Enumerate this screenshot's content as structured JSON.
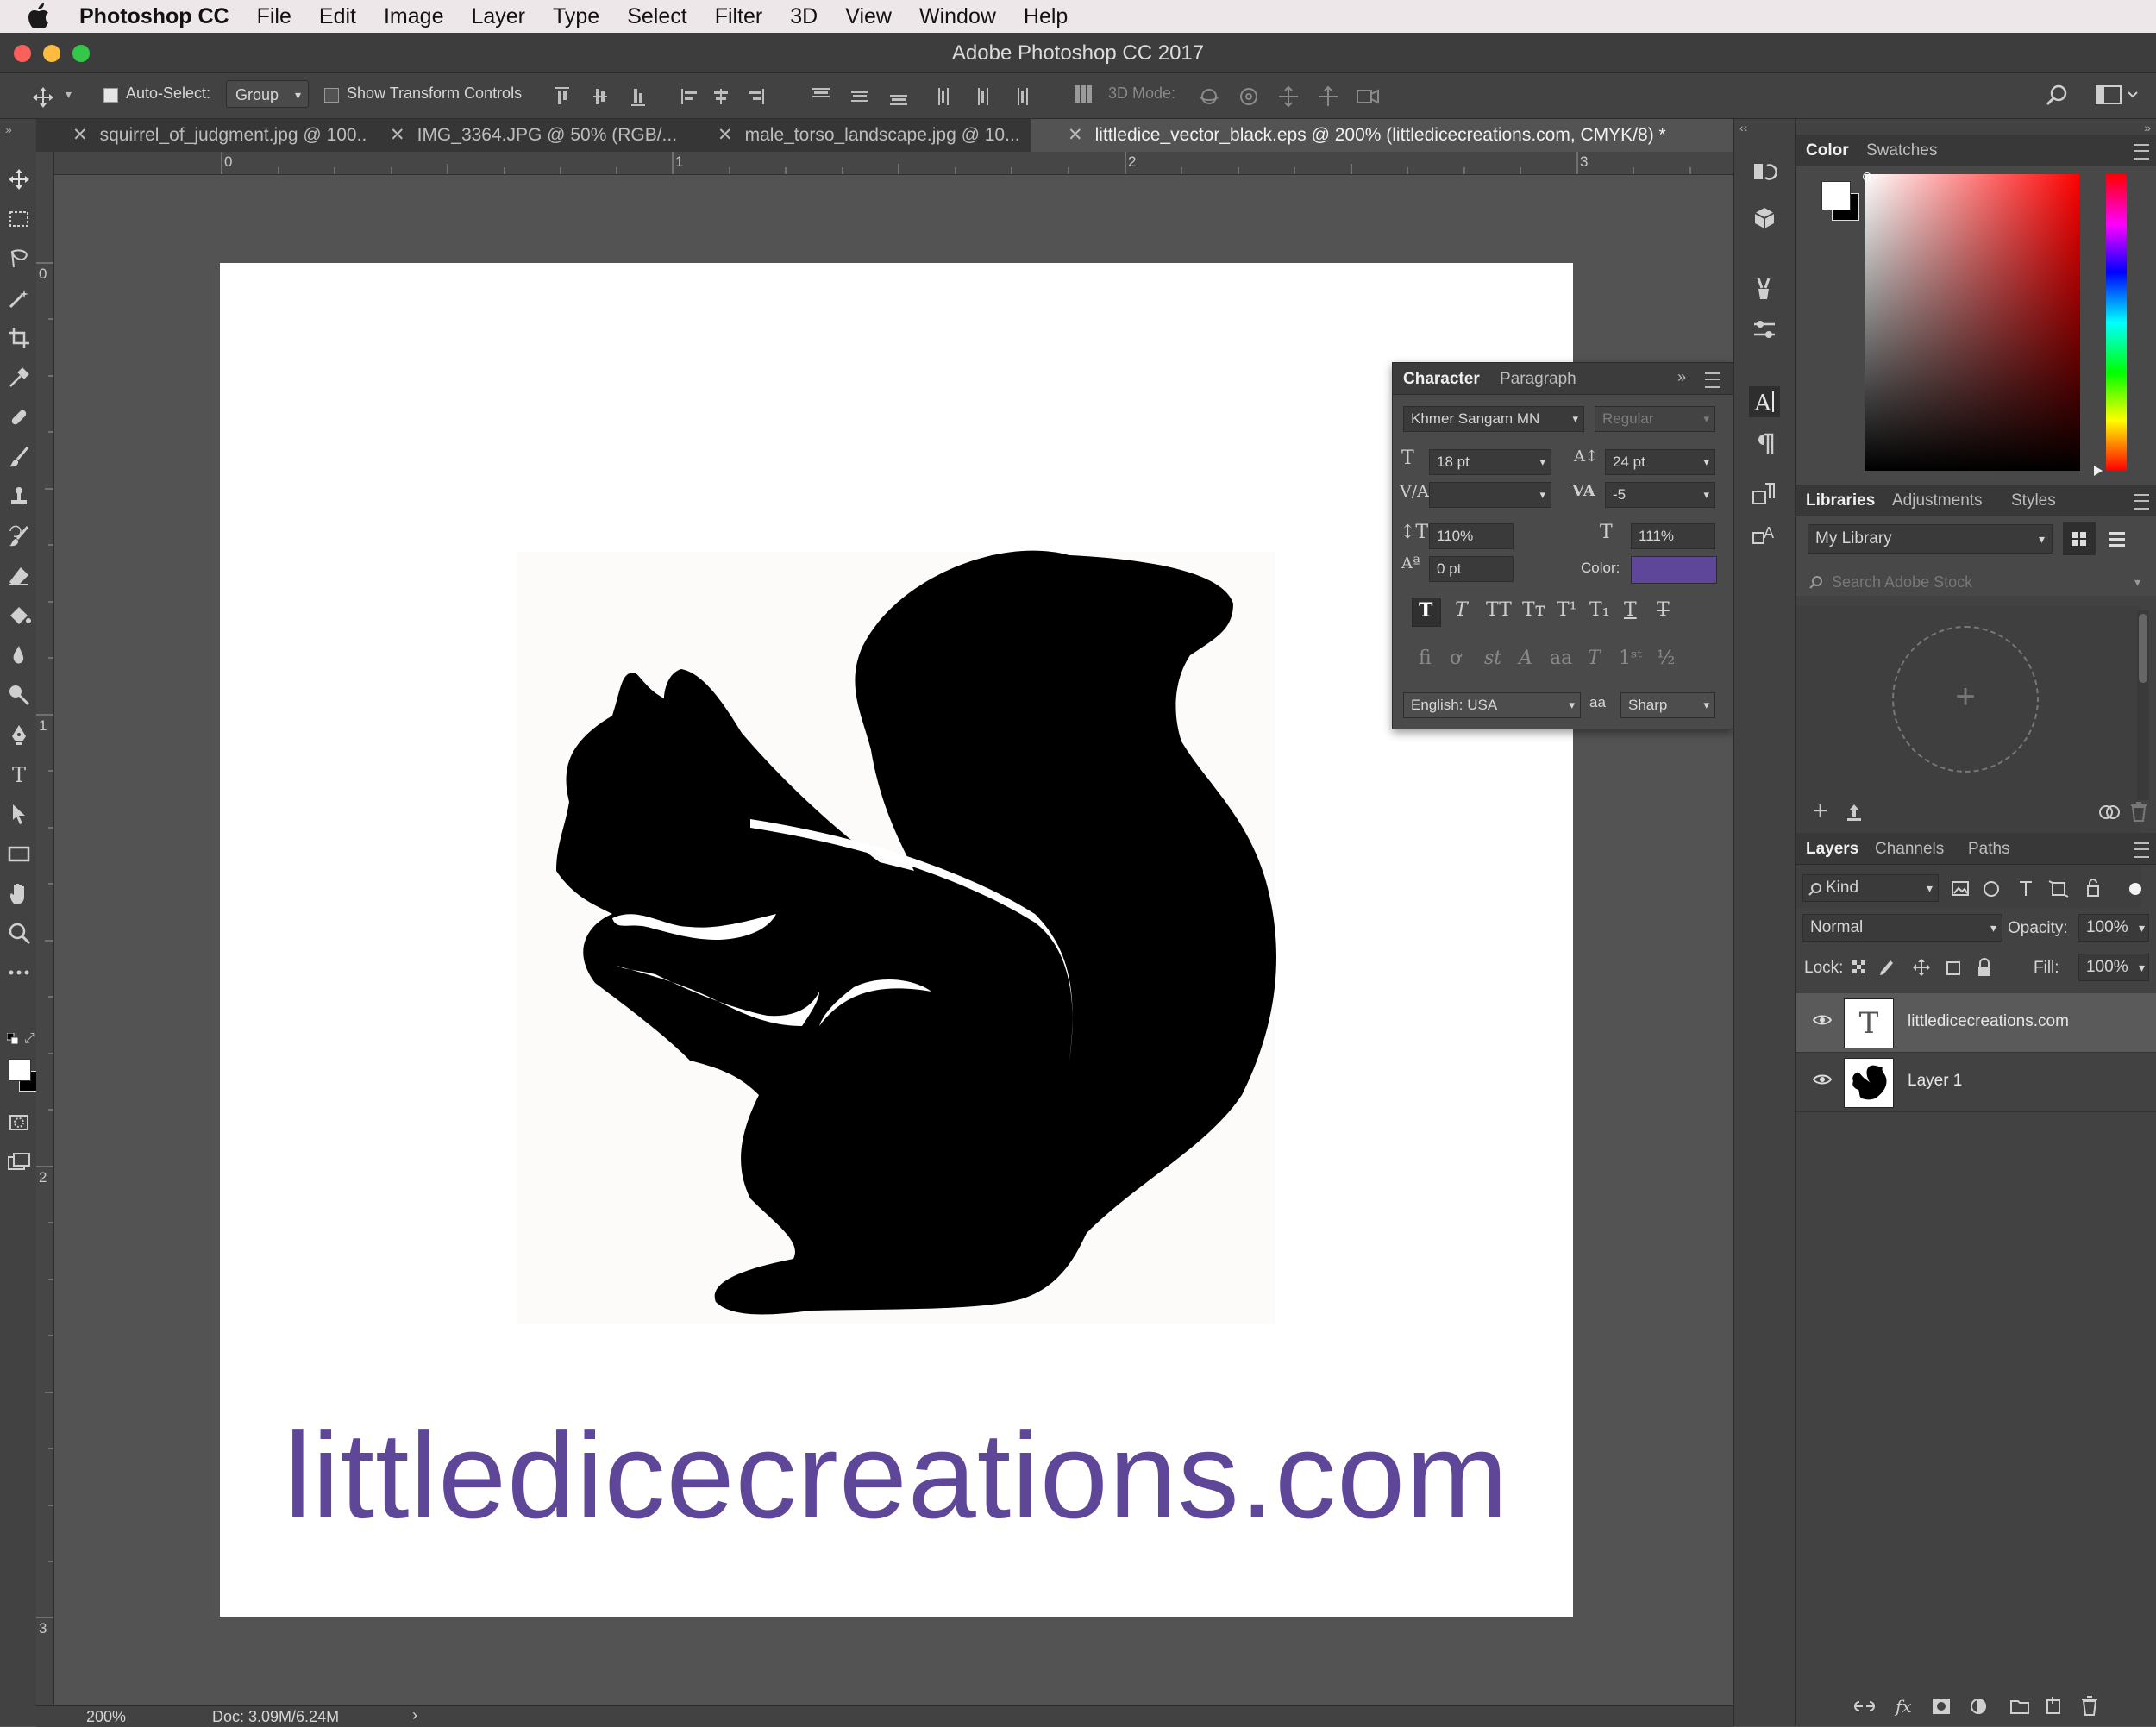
{
  "menubar": {
    "app_name": "Photoshop CC",
    "items": [
      "File",
      "Edit",
      "Image",
      "Layer",
      "Type",
      "Select",
      "Filter",
      "3D",
      "View",
      "Window",
      "Help"
    ]
  },
  "window": {
    "title": "Adobe Photoshop CC 2017"
  },
  "options_bar": {
    "auto_select_label": "Auto-Select:",
    "auto_select_checked": true,
    "auto_select_target": "Group",
    "show_transform_label": "Show Transform Controls",
    "show_transform_checked": false,
    "mode_3d_label": "3D Mode:"
  },
  "tabs": [
    {
      "label": "squirrel_of_judgment.jpg @ 100...",
      "active": false
    },
    {
      "label": "IMG_3364.JPG @ 50% (RGB/...",
      "active": false
    },
    {
      "label": "male_torso_landscape.jpg @ 10...",
      "active": false
    },
    {
      "label": "littledice_vector_black.eps @ 200% (littledicecreations.com, CMYK/8) *",
      "active": true
    }
  ],
  "rulers": {
    "top_labels": [
      "0",
      "1",
      "2",
      "3"
    ],
    "left_labels": [
      "0",
      "1",
      "2",
      "3"
    ]
  },
  "canvas": {
    "text_layer_content": "littledicecreations.com",
    "text_color": "#5e4699"
  },
  "character_panel": {
    "tabs": [
      "Character",
      "Paragraph"
    ],
    "active_tab": "Character",
    "font_family": "Khmer Sangam MN",
    "font_style": "Regular",
    "font_size": "18 pt",
    "leading": "24 pt",
    "kerning": "",
    "tracking": "-5",
    "vertical_scale": "110%",
    "horizontal_scale": "111%",
    "baseline_shift": "0 pt",
    "color_label": "Color:",
    "color_swatch": "#5e4699",
    "language": "English: USA",
    "aa_label": "aa",
    "antialias": "Sharp"
  },
  "color_panel": {
    "tabs": [
      "Color",
      "Swatches"
    ],
    "active_tab": "Color",
    "foreground": "#ffffff",
    "background": "#000000"
  },
  "libraries_panel": {
    "tabs": [
      "Libraries",
      "Adjustments",
      "Styles"
    ],
    "active_tab": "Libraries",
    "library_name": "My Library",
    "search_placeholder": "Search Adobe Stock"
  },
  "layers_panel": {
    "tabs": [
      "Layers",
      "Channels",
      "Paths"
    ],
    "active_tab": "Layers",
    "filter_kind": "Kind",
    "blend_mode": "Normal",
    "opacity_label": "Opacity:",
    "opacity": "100%",
    "lock_label": "Lock:",
    "fill_label": "Fill:",
    "fill": "100%",
    "layers": [
      {
        "name": "littledicecreations.com",
        "type": "text",
        "visible": true,
        "selected": true
      },
      {
        "name": "Layer 1",
        "type": "pixel",
        "visible": true,
        "selected": false
      }
    ]
  },
  "status_bar": {
    "zoom": "200%",
    "doc_info": "Doc: 3.09M/6.24M"
  }
}
